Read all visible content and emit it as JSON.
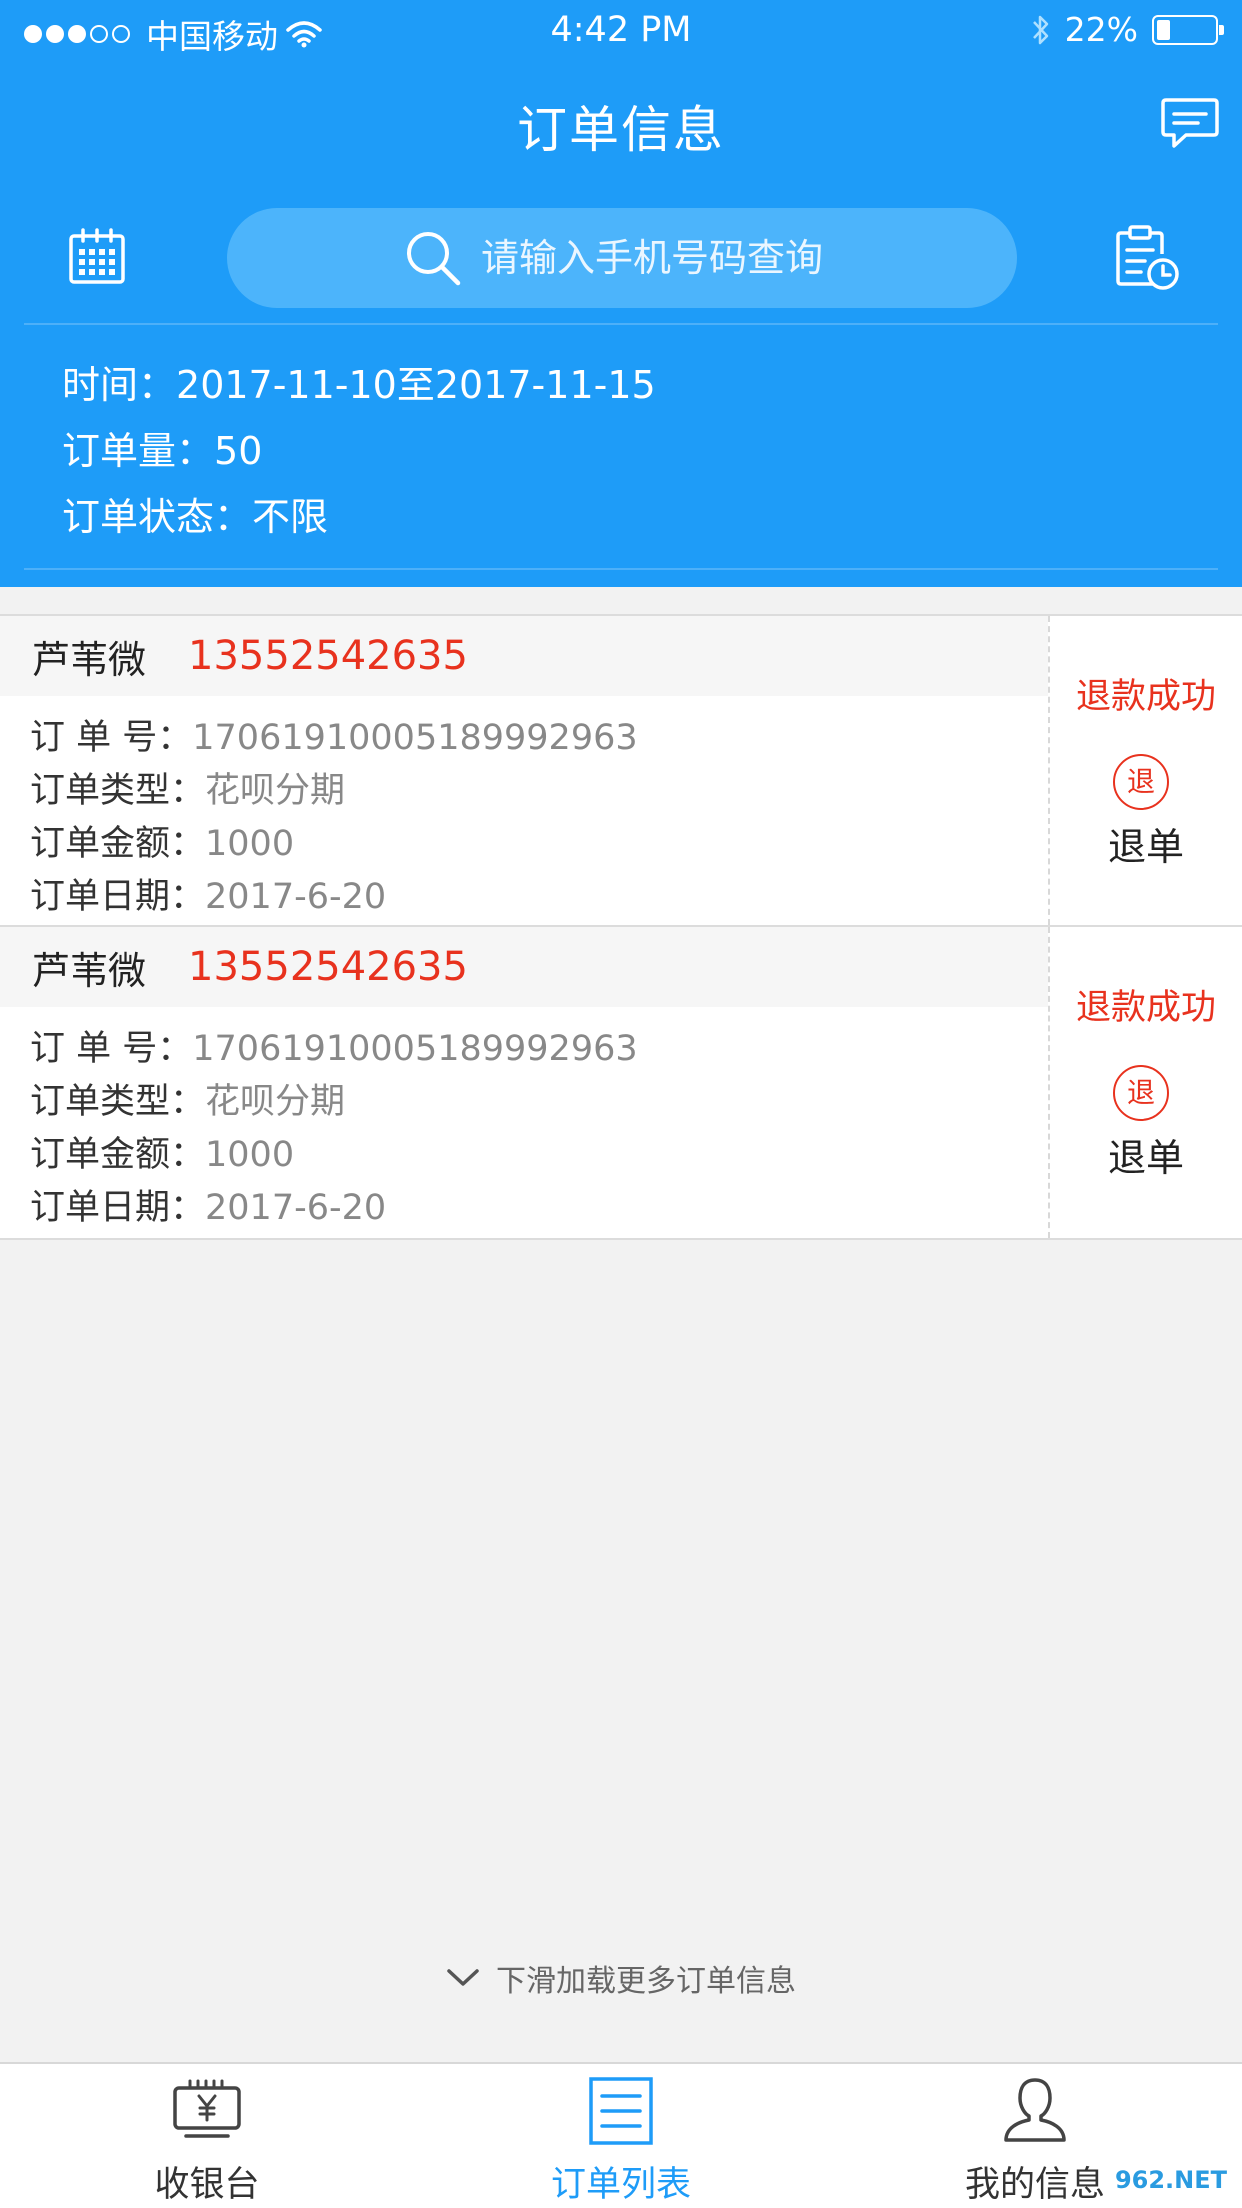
{
  "status_bar": {
    "carrier": "中国移动",
    "time": "4:42 PM",
    "battery": "22%",
    "signal_bars": 3
  },
  "navbar": {
    "title": "订单信息",
    "message_icon": "chat-bubble-icon"
  },
  "search": {
    "placeholder": "请输入手机号码查询",
    "calendar_icon": "calendar-icon",
    "report_icon": "clipboard-clock-icon"
  },
  "filters": {
    "time_label": "时间：",
    "time_value": "2017-11-10至2017-11-15",
    "count_label": "订单量：",
    "count_value": "50",
    "status_label": "订单状态：",
    "status_value": "不限"
  },
  "orders": [
    {
      "name": "芦苇微",
      "phone": "13552542635",
      "no_label": "订 单 号：",
      "no": "17061910005189992963",
      "type_label": "订单类型：",
      "type": "花呗分期",
      "amount_label": "订单金额：",
      "amount": "1000",
      "date_label": "订单日期：",
      "date": "2017-6-20",
      "refund_status": "退款成功",
      "refund_badge": "退",
      "refund_action": "退单"
    },
    {
      "name": "芦苇微",
      "phone": "13552542635",
      "no_label": "订 单 号：",
      "no": "17061910005189992963",
      "type_label": "订单类型：",
      "type": "花呗分期",
      "amount_label": "订单金额：",
      "amount": "1000",
      "date_label": "订单日期：",
      "date": "2017-6-20",
      "refund_status": "退款成功",
      "refund_badge": "退",
      "refund_action": "退单"
    }
  ],
  "load_more": "下滑加载更多订单信息",
  "tabbar": {
    "tabs": [
      {
        "label": "收银台",
        "icon": "cashier-icon",
        "active": false
      },
      {
        "label": "订单列表",
        "icon": "order-list-icon",
        "active": true
      },
      {
        "label": "我的信息",
        "icon": "user-icon",
        "active": false
      }
    ]
  },
  "watermark": "962.NET",
  "colors": {
    "header_blue": "#1e9cf8",
    "search_blue": "#4cb4fb",
    "accent_red": "#e8321e",
    "background": "#f2f2f2"
  }
}
